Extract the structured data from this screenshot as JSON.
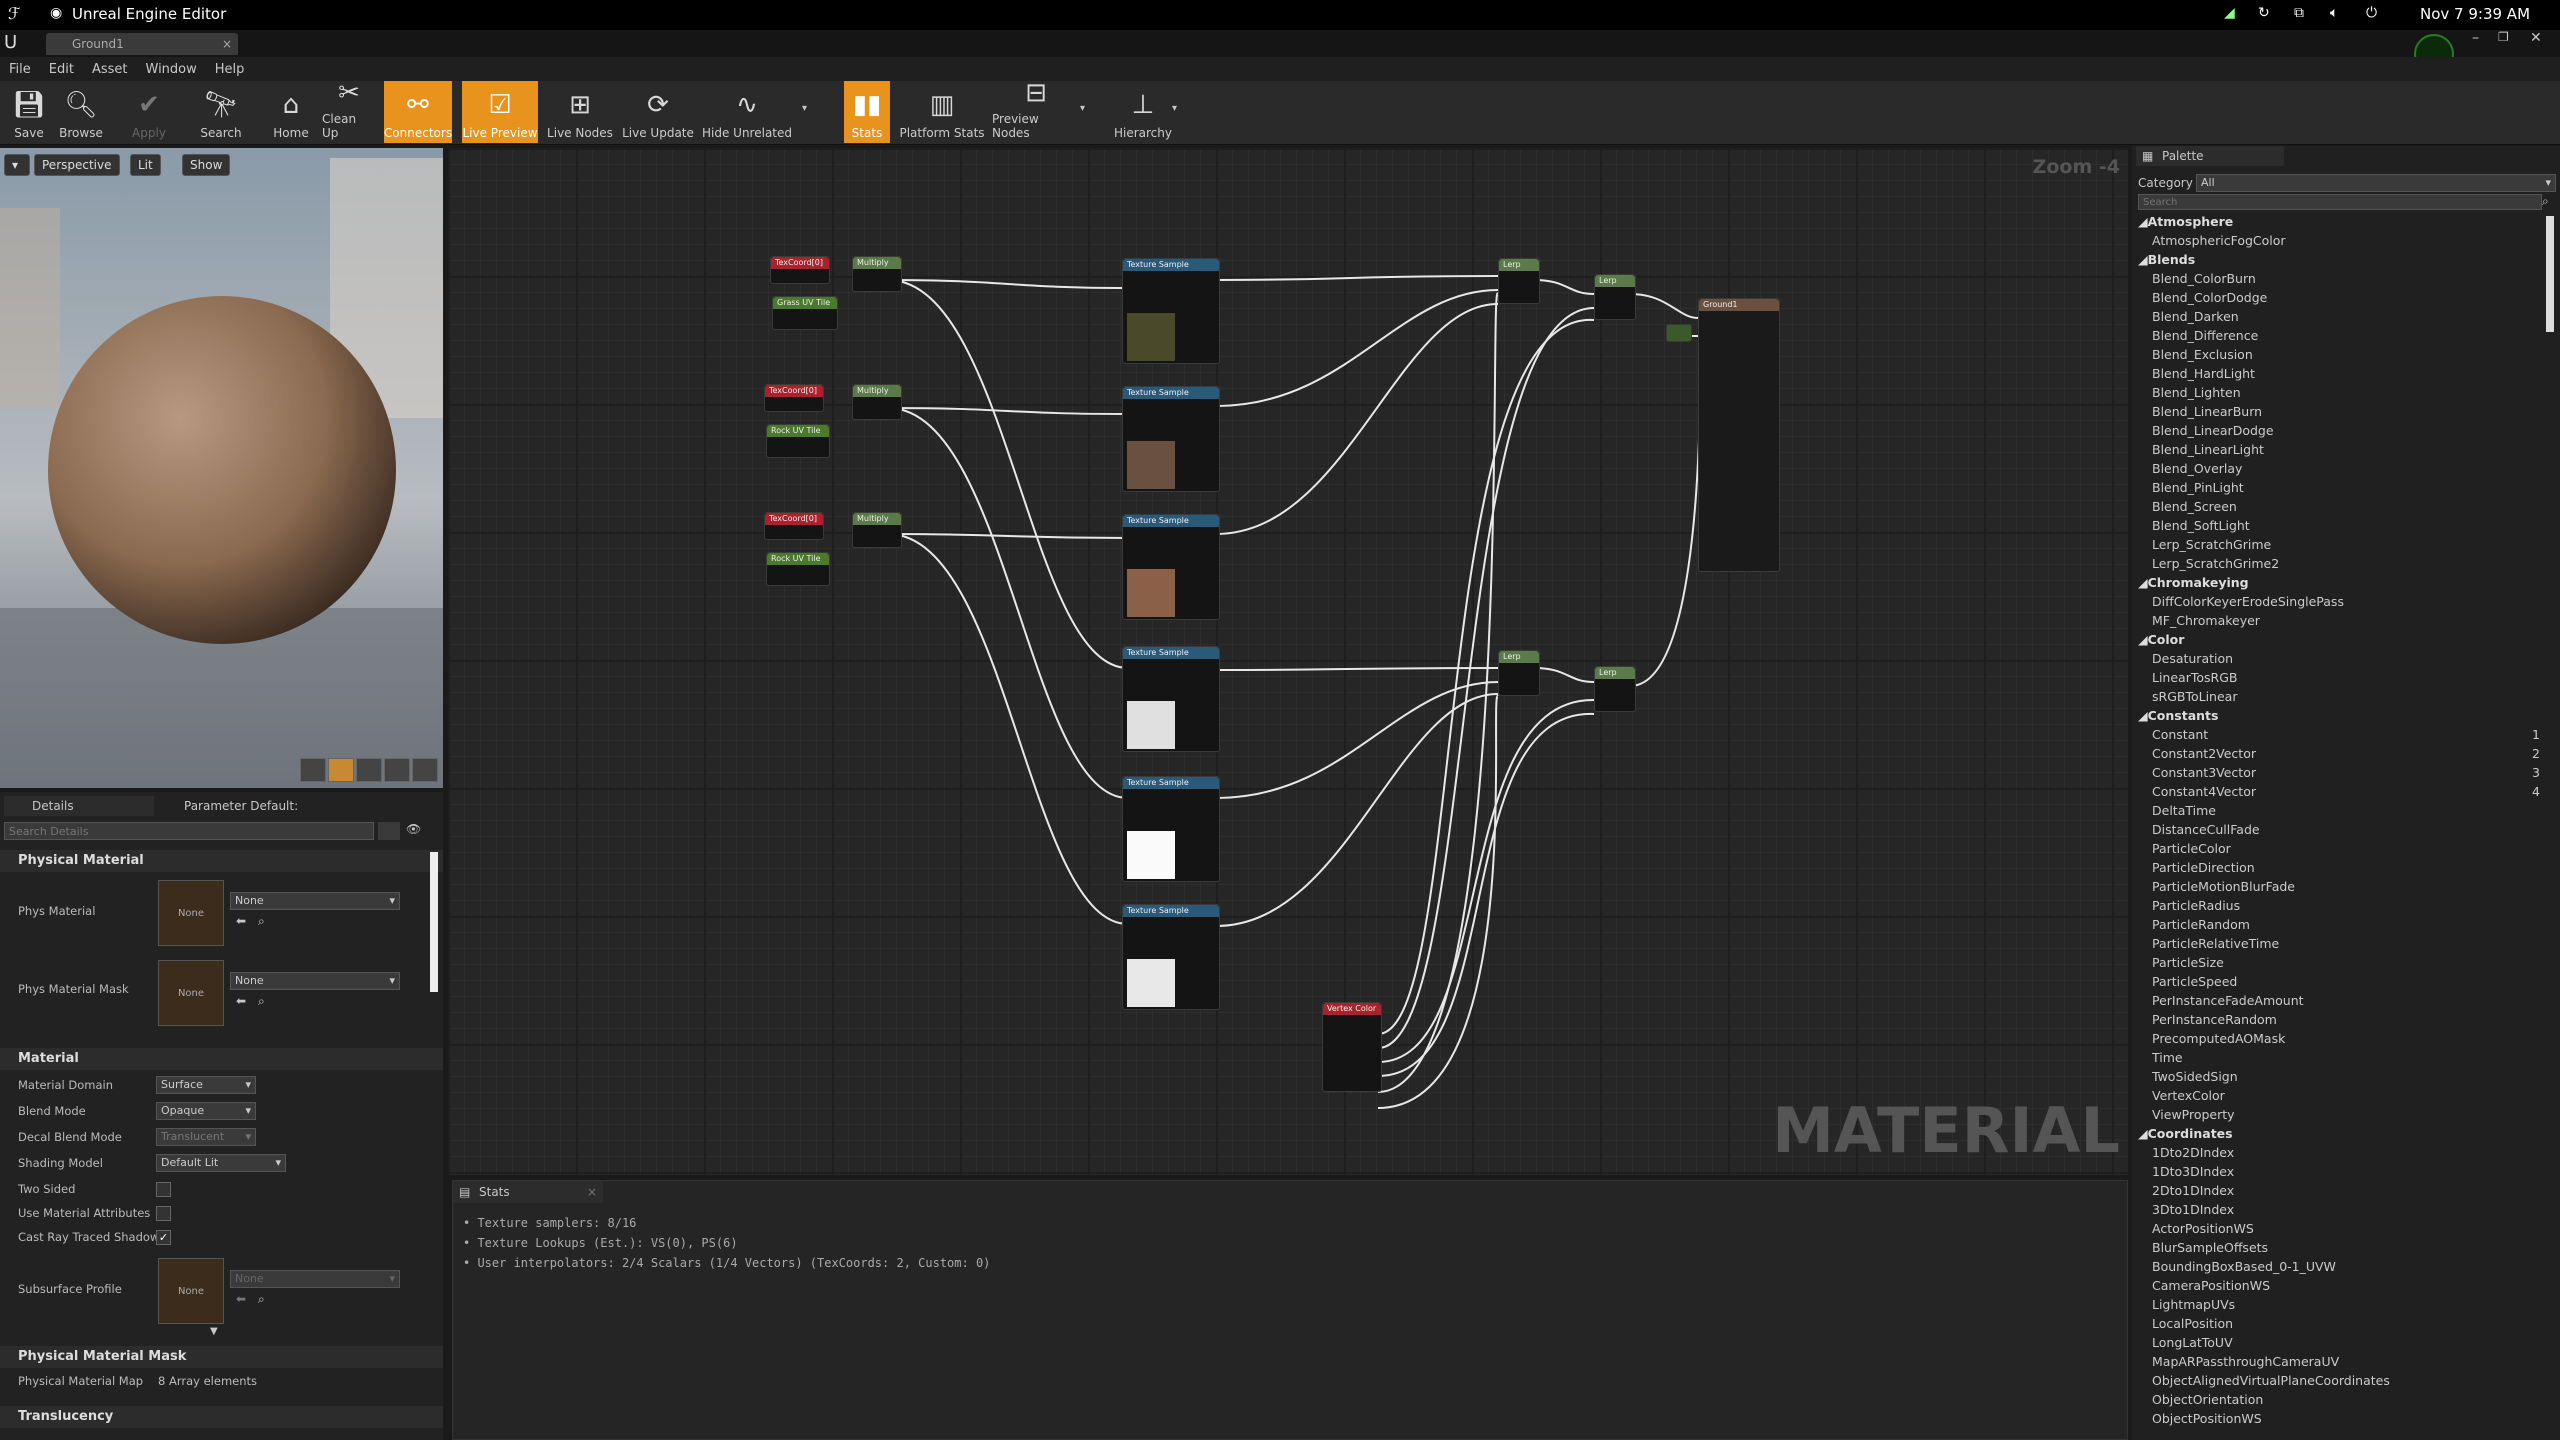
{
  "system": {
    "app_title": "Unreal Engine Editor",
    "datetime": "Nov 7  9:39 AM"
  },
  "tab": {
    "title": "Ground1"
  },
  "menu": [
    "File",
    "Edit",
    "Asset",
    "Window",
    "Help"
  ],
  "toolbar": {
    "save": "Save",
    "browse": "Browse",
    "apply": "Apply",
    "search": "Search",
    "home": "Home",
    "cleanup": "Clean Up",
    "connectors": "Connectors",
    "live_preview": "Live Preview",
    "live_nodes": "Live Nodes",
    "live_update": "Live Update",
    "hide_unrelated": "Hide Unrelated",
    "stats": "Stats",
    "platform_stats": "Platform Stats",
    "preview_nodes": "Preview Nodes",
    "hierarchy": "Hierarchy"
  },
  "viewport": {
    "perspective": "Perspective",
    "lit": "Lit",
    "show": "Show"
  },
  "details": {
    "tab_details": "Details",
    "tab_param": "Parameter Default:",
    "search_placeholder": "Search Details",
    "physical_material": "Physical Material",
    "phys_material": "Phys Material",
    "phys_material_mask": "Phys Material Mask",
    "none": "None",
    "material": "Material",
    "material_domain": "Material Domain",
    "material_domain_val": "Surface",
    "blend_mode": "Blend Mode",
    "blend_mode_val": "Opaque",
    "decal_blend_mode": "Decal Blend Mode",
    "decal_blend_mode_val": "Translucent",
    "shading_model": "Shading Model",
    "shading_model_val": "Default Lit",
    "two_sided": "Two Sided",
    "use_material_attributes": "Use Material Attributes",
    "cast_ray_traced_shadows": "Cast Ray Traced Shadows",
    "subsurface_profile": "Subsurface Profile",
    "physical_material_mask": "Physical Material Mask",
    "physical_material_map": "Physical Material Map",
    "array_elements": "8 Array elements",
    "translucency": "Translucency"
  },
  "graph": {
    "zoom": "Zoom -4",
    "watermark": "MATERIAL",
    "nodes": {
      "texcoord": "TexCoord[0]",
      "multiply": "Multiply",
      "grass_uv": "Grass UV Tile",
      "rock_uv": "Rock UV Tile",
      "texture_sample": "Texture Sample",
      "lerp": "Lerp",
      "result": "Ground1",
      "vertex_color": "Vertex Color"
    }
  },
  "stats": {
    "title": "Stats",
    "lines": [
      "Texture samplers: 8/16",
      "Texture Lookups (Est.): VS(0), PS(6)",
      "User interpolators: 2/4 Scalars (1/4 Vectors) (TexCoords: 2, Custom: 0)"
    ]
  },
  "palette": {
    "title": "Palette",
    "category_label": "Category",
    "category_value": "All",
    "search_placeholder": "Search",
    "items": [
      {
        "t": "Atmosphere",
        "c": true
      },
      {
        "t": "AtmosphericFogColor"
      },
      {
        "t": "Blends",
        "c": true
      },
      {
        "t": "Blend_ColorBurn"
      },
      {
        "t": "Blend_ColorDodge"
      },
      {
        "t": "Blend_Darken"
      },
      {
        "t": "Blend_Difference"
      },
      {
        "t": "Blend_Exclusion"
      },
      {
        "t": "Blend_HardLight"
      },
      {
        "t": "Blend_Lighten"
      },
      {
        "t": "Blend_LinearBurn"
      },
      {
        "t": "Blend_LinearDodge"
      },
      {
        "t": "Blend_LinearLight"
      },
      {
        "t": "Blend_Overlay"
      },
      {
        "t": "Blend_PinLight"
      },
      {
        "t": "Blend_Screen"
      },
      {
        "t": "Blend_SoftLight"
      },
      {
        "t": "Lerp_ScratchGrime"
      },
      {
        "t": "Lerp_ScratchGrime2"
      },
      {
        "t": "Chromakeying",
        "c": true
      },
      {
        "t": "DiffColorKeyerErodeSinglePass"
      },
      {
        "t": "MF_Chromakeyer"
      },
      {
        "t": "Color",
        "c": true
      },
      {
        "t": "Desaturation"
      },
      {
        "t": "LinearTosRGB"
      },
      {
        "t": "sRGBToLinear"
      },
      {
        "t": "Constants",
        "c": true
      },
      {
        "t": "Constant",
        "k": "1"
      },
      {
        "t": "Constant2Vector",
        "k": "2"
      },
      {
        "t": "Constant3Vector",
        "k": "3"
      },
      {
        "t": "Constant4Vector",
        "k": "4"
      },
      {
        "t": "DeltaTime"
      },
      {
        "t": "DistanceCullFade"
      },
      {
        "t": "ParticleColor"
      },
      {
        "t": "ParticleDirection"
      },
      {
        "t": "ParticleMotionBlurFade"
      },
      {
        "t": "ParticleRadius"
      },
      {
        "t": "ParticleRandom"
      },
      {
        "t": "ParticleRelativeTime"
      },
      {
        "t": "ParticleSize"
      },
      {
        "t": "ParticleSpeed"
      },
      {
        "t": "PerInstanceFadeAmount"
      },
      {
        "t": "PerInstanceRandom"
      },
      {
        "t": "PrecomputedAOMask"
      },
      {
        "t": "Time"
      },
      {
        "t": "TwoSidedSign"
      },
      {
        "t": "VertexColor"
      },
      {
        "t": "ViewProperty"
      },
      {
        "t": "Coordinates",
        "c": true
      },
      {
        "t": "1Dto2DIndex"
      },
      {
        "t": "1Dto3DIndex"
      },
      {
        "t": "2Dto1DIndex"
      },
      {
        "t": "3Dto1DIndex"
      },
      {
        "t": "ActorPositionWS"
      },
      {
        "t": "BlurSampleOffsets"
      },
      {
        "t": "BoundingBoxBased_0-1_UVW"
      },
      {
        "t": "CameraPositionWS"
      },
      {
        "t": "LightmapUVs"
      },
      {
        "t": "LocalPosition"
      },
      {
        "t": "LongLatToUV"
      },
      {
        "t": "MapARPassthroughCameraUV"
      },
      {
        "t": "ObjectAlignedVirtualPlaneCoordinates"
      },
      {
        "t": "ObjectOrientation"
      },
      {
        "t": "ObjectPositionWS"
      }
    ]
  },
  "colors": {
    "accent": "#e8931e",
    "texcoord_header": "#a8242c",
    "multiply_header": "#5a7a4a",
    "texture_header": "#2a5a7a",
    "param_header": "#4a7a2a"
  }
}
